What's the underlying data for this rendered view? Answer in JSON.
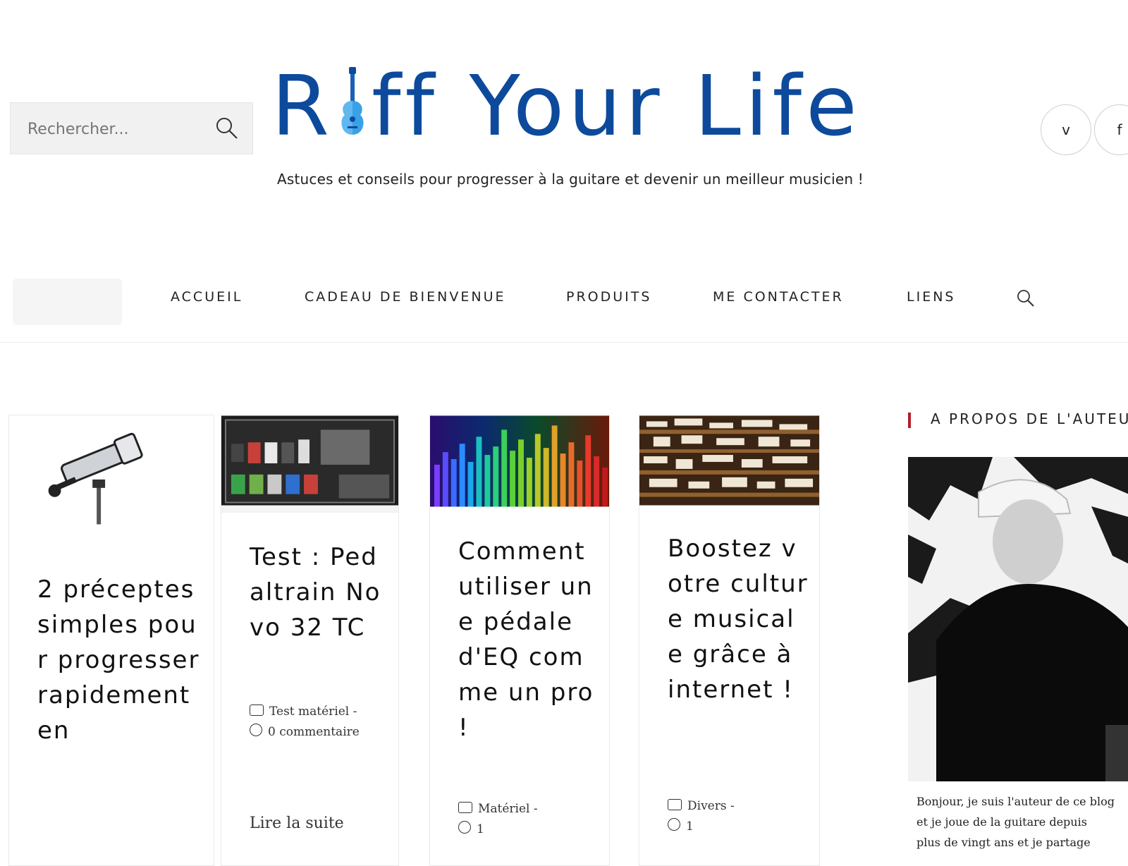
{
  "header": {
    "search_placeholder": "Rechercher...",
    "logo_text_before": "R",
    "logo_text_after": "ff Your Life",
    "tagline": "Astuces et conseils pour progresser à la guitare et devenir un meilleur musicien !",
    "brand_color": "#0d4a9c",
    "social": [
      {
        "icon": "v",
        "name": "social-icon-1"
      },
      {
        "icon": "f",
        "name": "social-icon-2"
      }
    ]
  },
  "nav": {
    "items": [
      "ACCUEIL",
      "CADEAU DE BIENVENUE",
      "PRODUITS",
      "ME CONTACTER",
      "LIENS"
    ]
  },
  "cards": [
    {
      "title": "2 préceptes simples pour progresser rapidement en",
      "meta_date": "",
      "meta_comments": "",
      "more": ""
    },
    {
      "title": "Test : Pedaltrain Novo 32 TC",
      "meta_date": "Test matériel -",
      "meta_comments": "0 commentaire",
      "more": "Lire la suite"
    },
    {
      "title": "Comment utiliser une pédale d'EQ comme un pro !",
      "meta_date": "Matériel -",
      "meta_comments": "1",
      "more": ""
    },
    {
      "title": "Boostez votre culture musicale grâce à internet !",
      "meta_date": "Divers -",
      "meta_comments": "1",
      "more": ""
    }
  ],
  "sidebar": {
    "heading": "A PROPOS DE L'AUTEUR",
    "accent_color": "#b11f2a",
    "bio_line1": "Bonjour, je suis l'auteur de ce blog",
    "bio_line2": "et je joue de la guitare depuis",
    "bio_line3": "plus de vingt ans et je partage"
  }
}
